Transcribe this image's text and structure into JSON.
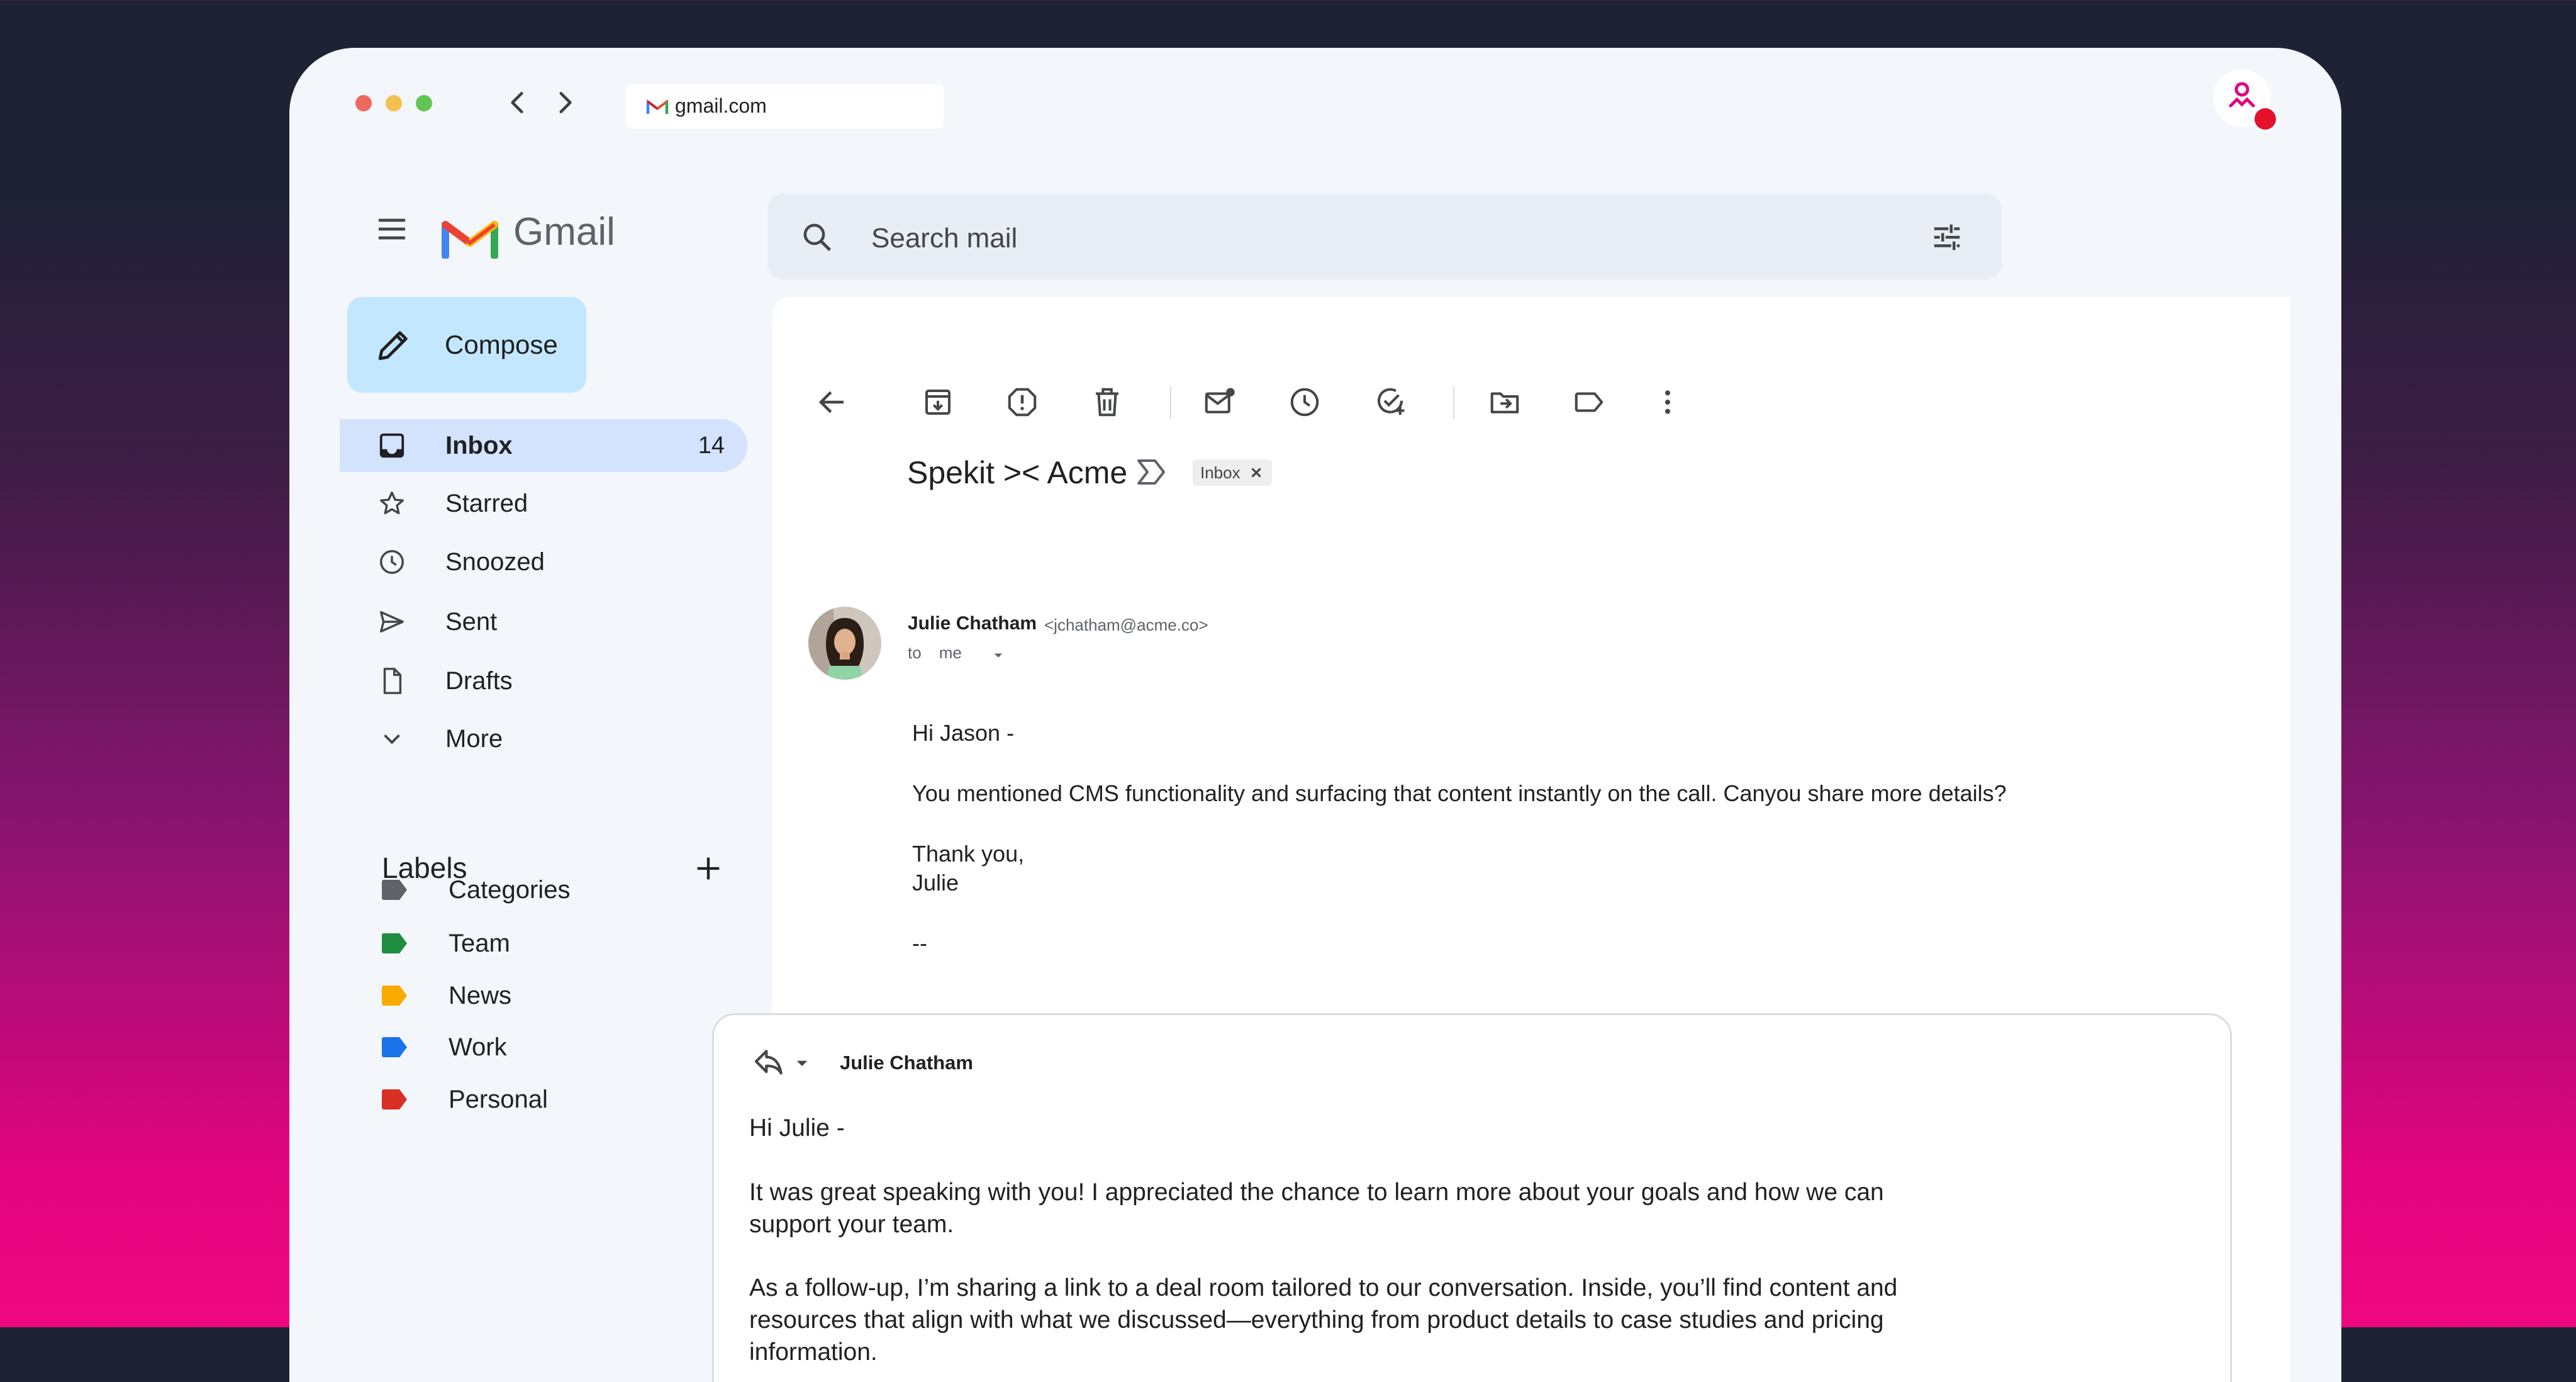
{
  "browser": {
    "url": "gmail.com",
    "icons": {
      "back": "chevron-left-icon",
      "forward": "chevron-right-icon",
      "extension": "spekit-extension-icon"
    }
  },
  "app": {
    "name": "Gmail"
  },
  "sidebar": {
    "compose_label": "Compose",
    "items": [
      {
        "label": "Inbox",
        "count": "14",
        "icon": "inbox-icon",
        "active": true
      },
      {
        "label": "Starred",
        "icon": "star-icon"
      },
      {
        "label": "Snoozed",
        "icon": "clock-icon"
      },
      {
        "label": "Sent",
        "icon": "send-icon"
      },
      {
        "label": "Drafts",
        "icon": "draft-icon"
      },
      {
        "label": "More",
        "icon": "chevron-down-icon"
      }
    ],
    "labels_heading": "Labels",
    "labels": [
      {
        "label": "Categories",
        "color": "#5f6368"
      },
      {
        "label": "Team",
        "color": "#1e8e3e"
      },
      {
        "label": "News",
        "color": "#f9ab00"
      },
      {
        "label": "Work",
        "color": "#1a73e8"
      },
      {
        "label": "Personal",
        "color": "#d93025"
      }
    ]
  },
  "search": {
    "placeholder": "Search mail"
  },
  "toolbar": {
    "icons": [
      "back-arrow-icon",
      "archive-icon",
      "report-spam-icon",
      "delete-icon",
      "mark-unread-icon",
      "snooze-icon",
      "add-task-icon",
      "move-to-icon",
      "label-icon",
      "more-vert-icon"
    ]
  },
  "email": {
    "subject": "Spekit >< Acme",
    "chip": "Inbox",
    "sender_name": "Julie Chatham",
    "sender_email": "<jchatham@acme.co>",
    "to_prefix": "to",
    "to_value": "me",
    "body": [
      "Hi Jason -",
      "You mentioned CMS functionality and surfacing that content instantly on the call. Canyou share more details?",
      "Thank you,",
      "Julie",
      "--"
    ]
  },
  "reply": {
    "to_name": "Julie Chatham",
    "body": [
      "Hi Julie -",
      "It was great speaking with you! I appreciated the chance to learn more about your goals and how we can",
      "support your team.",
      "As a follow-up, I’m sharing a link to a deal room tailored to our conversation. Inside, you’ll find content and",
      "resources that align with what we discussed—everything from product details to case studies and pricing",
      "information."
    ]
  },
  "colors": {
    "accent": "#c2e7ff",
    "active_nav": "#d3e3fd",
    "brand_pink": "#e2047e"
  }
}
